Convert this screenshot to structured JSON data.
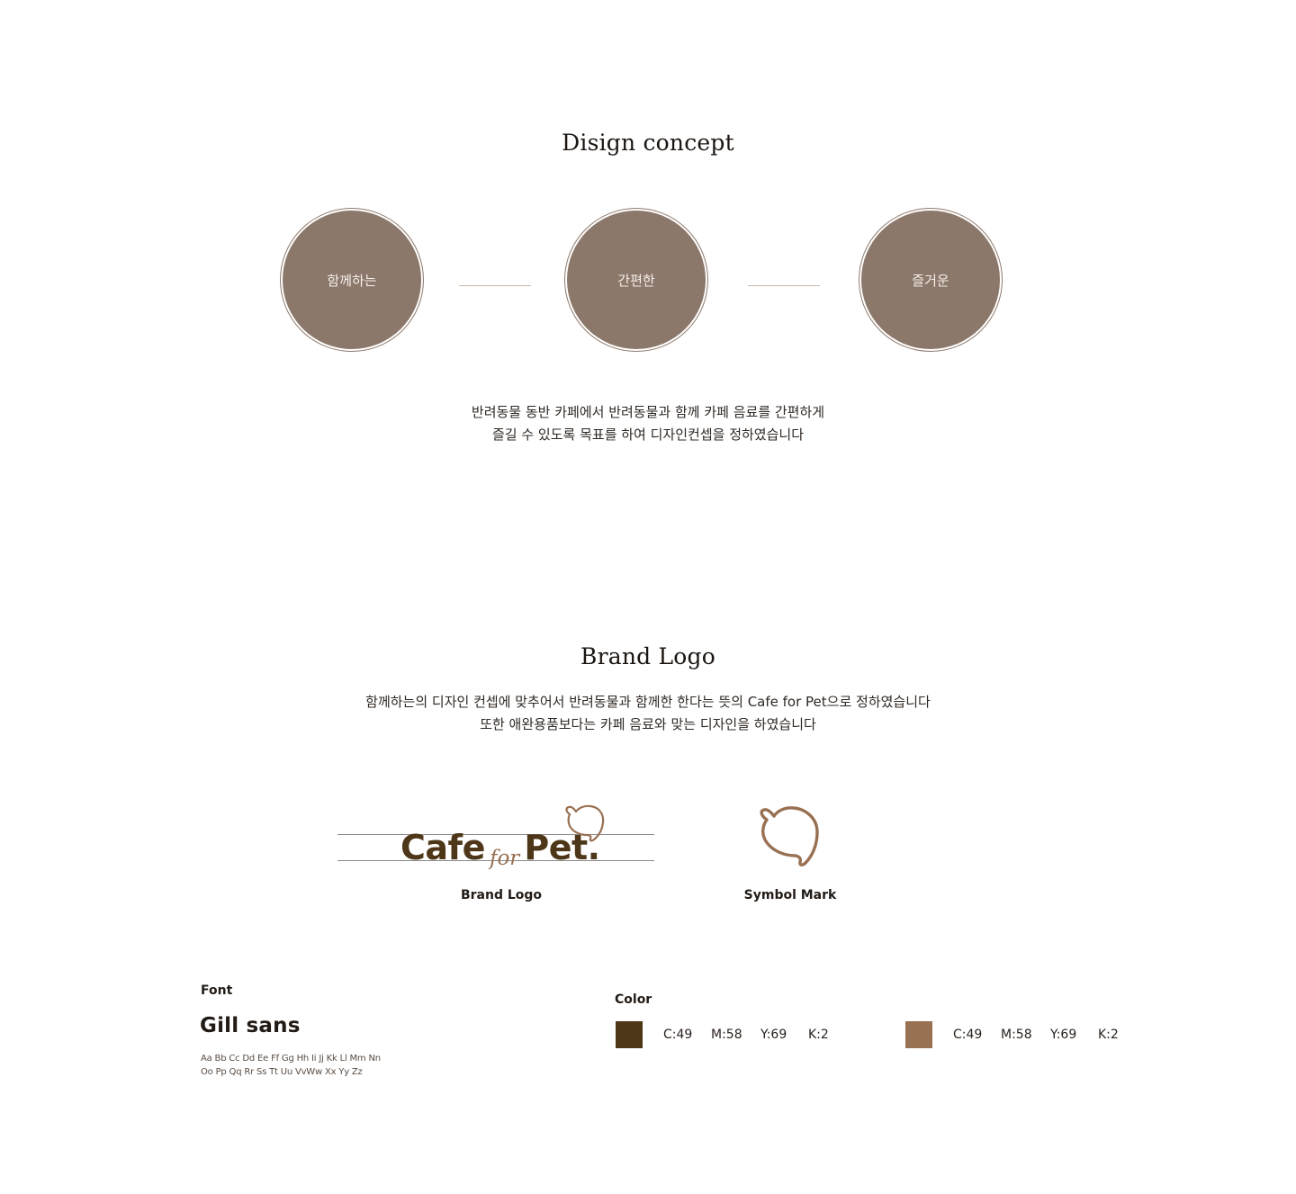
{
  "concept": {
    "title": "Disign concept",
    "circles": [
      "함께하는",
      "간편한",
      "즐거운"
    ],
    "description": [
      "반려동물 동반 카페에서 반려동물과 함께 카페 음료를 간편하게",
      "즐길 수 있도록 목표를 하여 디자인컨셉을 정하였습니다"
    ]
  },
  "brand": {
    "title": "Brand Logo",
    "description": [
      "함께하는의 디자인 컨셉에 맞추어서 반려동물과 함께한 한다는 뜻의 Cafe for Pet으로 정하였습니다",
      "또한 애완용품보다는 카페 음료와 맞는 디자인을 하였습니다"
    ],
    "logo": {
      "word_cafe": "Cafe",
      "word_for": "for",
      "word_pet": "Pet.",
      "label": "Brand Logo"
    },
    "symbol": {
      "label": "Symbol Mark",
      "icon": "dog-head-icon"
    }
  },
  "font": {
    "heading": "Font",
    "name": "Gill sans",
    "alphabet_line1": "Aa Bb Cc Dd Ee Ff Gg Hh Ii Jj Kk Ll Mm Nn",
    "alphabet_line2": "Oo Pp Qq Rr Ss Tt Uu VvWw Xx Yy Zz"
  },
  "color": {
    "heading": "Color",
    "swatches": [
      {
        "hex": "#4e3719",
        "c": "C:49",
        "m": "M:58",
        "y": "Y:69",
        "k": "K:2"
      },
      {
        "hex": "#987052",
        "c": "C:49",
        "m": "M:58",
        "y": "Y:69",
        "k": "K:2"
      }
    ]
  },
  "palette": {
    "logo_dark": "#4e3719",
    "logo_light": "#987052",
    "circle_fill": "#8c786b"
  }
}
